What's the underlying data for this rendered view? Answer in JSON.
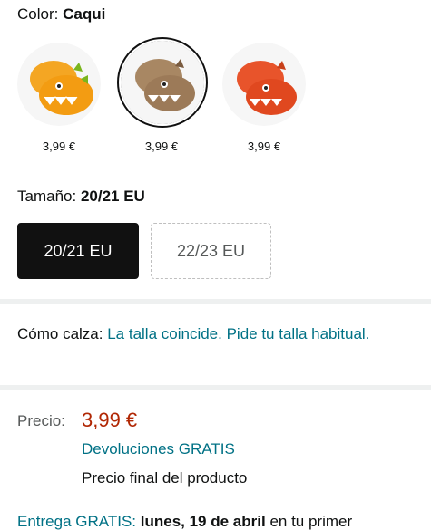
{
  "color": {
    "label": "Color:",
    "selected": "Caqui"
  },
  "swatches": [
    {
      "price": "3,99 €",
      "name": "yellow-dino-slipper",
      "fill": "#f4a623"
    },
    {
      "price": "3,99 €",
      "name": "khaki-dino-slipper",
      "fill": "#a07c5b"
    },
    {
      "price": "3,99 €",
      "name": "orange-dino-slipper",
      "fill": "#e8542b"
    }
  ],
  "size": {
    "label": "Tamaño:",
    "selected": "20/21 EU",
    "options": [
      "20/21 EU",
      "22/23 EU"
    ]
  },
  "fit": {
    "label": "Cómo calza:",
    "link": "La talla coincide. Pide tu talla habitual."
  },
  "price": {
    "label": "Precio:",
    "value": "3,99 €",
    "returns": "Devoluciones GRATIS",
    "final": "Precio final del producto"
  },
  "delivery": {
    "link": "Entrega GRATIS:",
    "date": "lunes, 19 de abril",
    "rest": "en tu primer"
  },
  "colors": {
    "link": "#007185",
    "price": "#b12704",
    "selected_size_bg": "#111111"
  }
}
